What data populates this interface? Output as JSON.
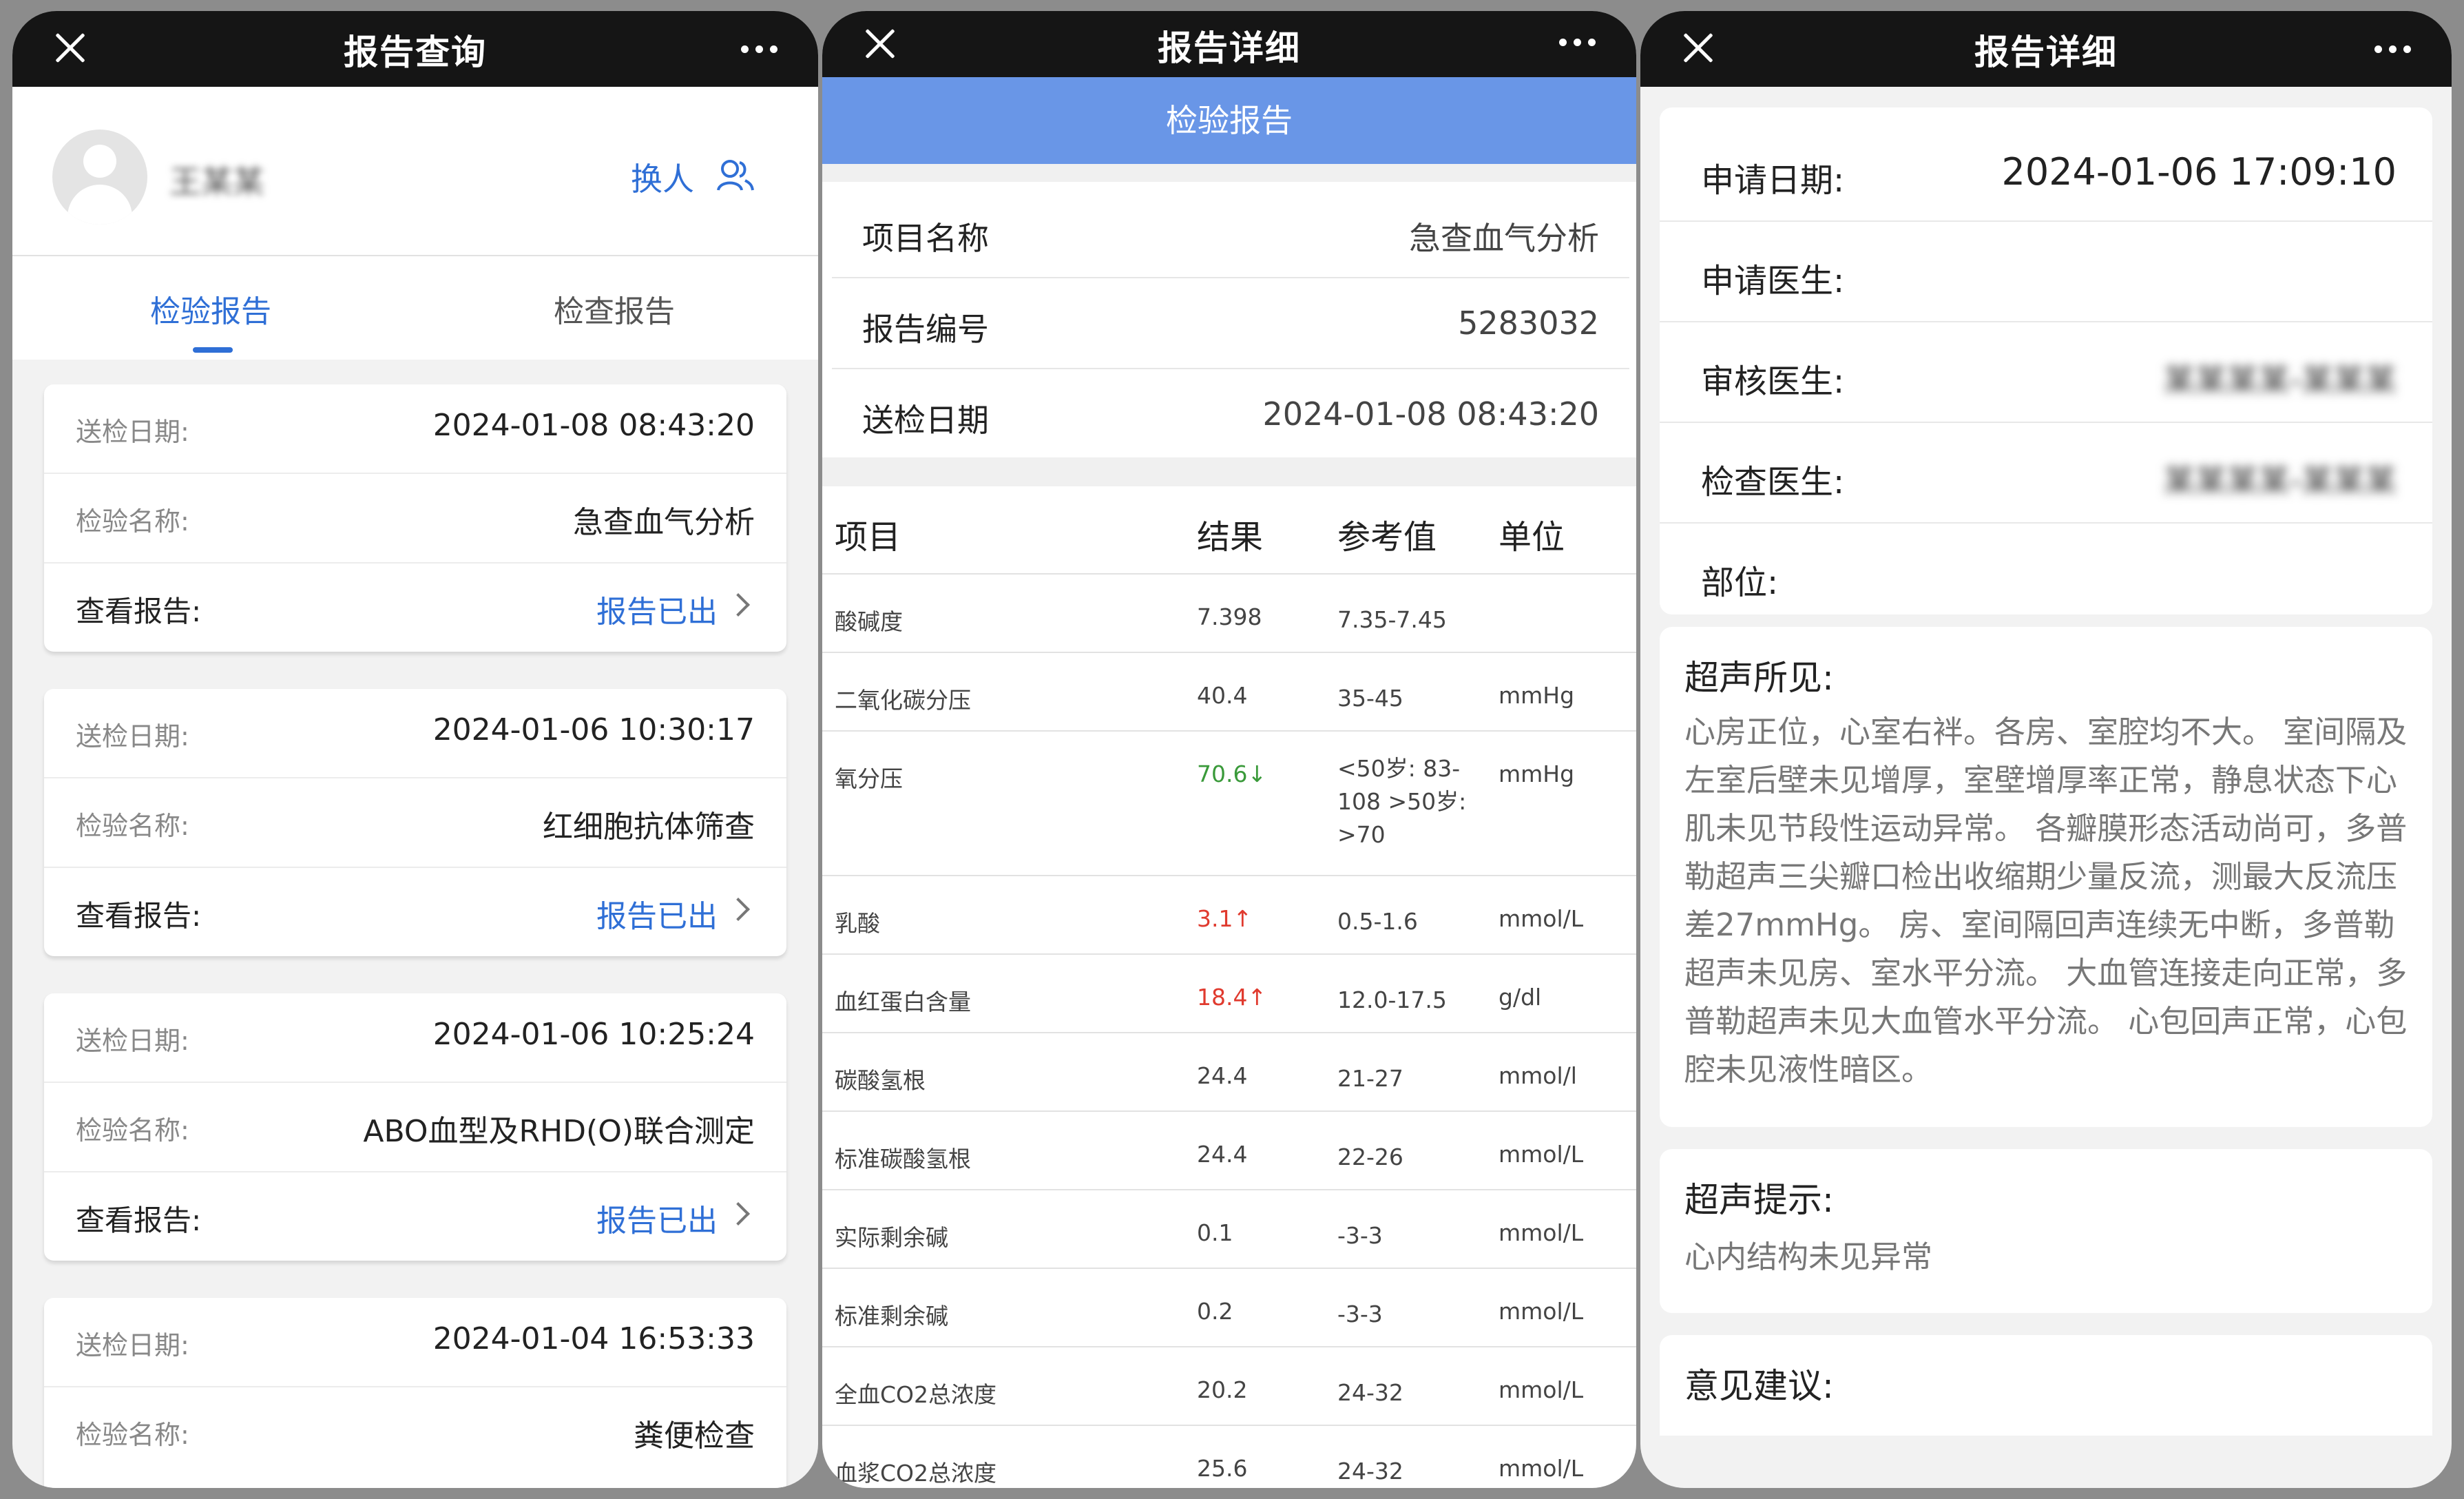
{
  "query": {
    "title": "报告查询",
    "user_name": "王某某",
    "switch_label": "换人",
    "tabs": [
      "检验报告",
      "检查报告"
    ],
    "labels": {
      "date": "送检日期:",
      "name": "检验名称:",
      "view": "查看报告:"
    },
    "reports": [
      {
        "date": "2024-01-08 08:43:20",
        "name": "急查血气分析",
        "status": "报告已出"
      },
      {
        "date": "2024-01-06 10:30:17",
        "name": "红细胞抗体筛查",
        "status": "报告已出"
      },
      {
        "date": "2024-01-06 10:25:24",
        "name": "ABO血型及RHD(O)联合测定",
        "status": "报告已出"
      },
      {
        "date": "2024-01-04 16:53:33",
        "name": "粪便检查",
        "status": ""
      }
    ]
  },
  "lab_detail": {
    "title": "报告详细",
    "band": "检验报告",
    "info": [
      {
        "k": "项目名称",
        "v": "急查血气分析"
      },
      {
        "k": "报告编号",
        "v": "5283032"
      },
      {
        "k": "送检日期",
        "v": "2024-01-08 08:43:20"
      }
    ],
    "columns": [
      "项目",
      "结果",
      "参考值",
      "单位"
    ],
    "rows": [
      {
        "item": "酸碱度",
        "result": "7.398",
        "flag": "",
        "ref": "7.35-7.45",
        "unit": ""
      },
      {
        "item": "二氧化碳分压",
        "result": "40.4",
        "flag": "",
        "ref": "35-45",
        "unit": "mmHg"
      },
      {
        "item": "氧分压",
        "result": "70.6↓",
        "flag": "down",
        "ref": "<50岁: 83-108 >50岁: >70",
        "unit": "mmHg"
      },
      {
        "item": "乳酸",
        "result": "3.1↑",
        "flag": "up",
        "ref": "0.5-1.6",
        "unit": "mmol/L"
      },
      {
        "item": "血红蛋白含量",
        "result": "18.4↑",
        "flag": "up",
        "ref": "12.0-17.5",
        "unit": "g/dl"
      },
      {
        "item": "碳酸氢根",
        "result": "24.4",
        "flag": "",
        "ref": "21-27",
        "unit": "mmol/l"
      },
      {
        "item": "标准碳酸氢根",
        "result": "24.4",
        "flag": "",
        "ref": "22-26",
        "unit": "mmol/L"
      },
      {
        "item": "实际剩余碱",
        "result": "0.1",
        "flag": "",
        "ref": "-3-3",
        "unit": "mmol/L"
      },
      {
        "item": "标准剩余碱",
        "result": "0.2",
        "flag": "",
        "ref": "-3-3",
        "unit": "mmol/L"
      },
      {
        "item": "全血CO2总浓度",
        "result": "20.2",
        "flag": "",
        "ref": "24-32",
        "unit": "mmol/L"
      },
      {
        "item": "血浆CO2总浓度",
        "result": "25.6",
        "flag": "",
        "ref": "24-32",
        "unit": "mmol/L"
      }
    ]
  },
  "exam_detail": {
    "title": "报告详细",
    "fields": [
      {
        "k": "申请日期:",
        "v": "2024-01-06 17:09:10"
      },
      {
        "k": "申请医生:",
        "v": ""
      },
      {
        "k": "审核医生:",
        "v": "某某某某-某某某"
      },
      {
        "k": "检查医生:",
        "v": "某某某某-某某某"
      },
      {
        "k": "部位:",
        "v": ""
      }
    ],
    "findings_label": "超声所见:",
    "findings": "心房正位，心室右袢。各房、室腔均不大。 室间隔及左室后壁未见增厚，室壁增厚率正常，静息状态下心肌未见节段性运动异常。 各瓣膜形态活动尚可，多普勒超声三尖瓣口检出收缩期少量反流，测最大反流压差27mmHg。 房、室间隔回声连续无中断，多普勒超声未见房、室水平分流。 大血管连接走向正常，多普勒超声未见大血管水平分流。 心包回声正常，心包腔未见液性暗区。",
    "hint_label": "超声提示:",
    "hint": "心内结构未见异常",
    "advice_label": "意见建议:"
  },
  "colors": {
    "accent": "#2f6fd6",
    "band": "#6996e7",
    "up": "#e03a2e",
    "down": "#3a9a3a"
  }
}
